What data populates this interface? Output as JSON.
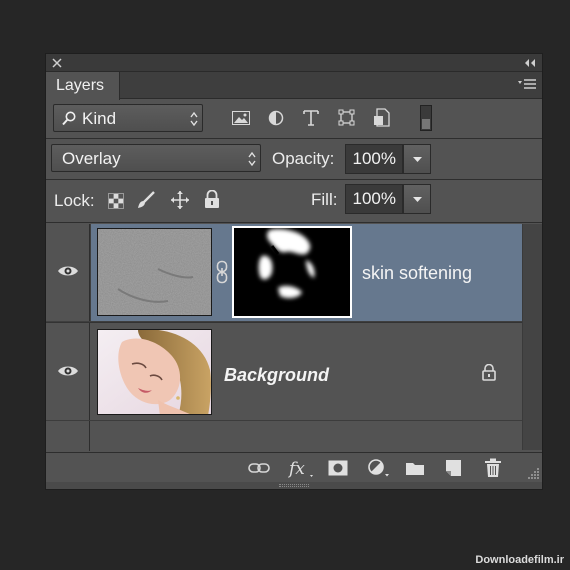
{
  "panel": {
    "title": "Layers",
    "filter": {
      "label": "Kind"
    },
    "blend_mode": "Overlay",
    "opacity": {
      "label": "Opacity:",
      "value": "100%"
    },
    "lock": {
      "label": "Lock:"
    },
    "fill": {
      "label": "Fill:",
      "value": "100%"
    },
    "layers": [
      {
        "name": "skin softening",
        "selected": true,
        "visible": true,
        "linked_mask": true
      },
      {
        "name": "Background",
        "selected": false,
        "visible": true,
        "locked": true
      }
    ],
    "filter_icons": [
      "image-filter-icon",
      "adjustment-filter-icon",
      "type-filter-icon",
      "shape-filter-icon",
      "smart-object-filter-icon",
      "filter-toggle-icon"
    ],
    "lock_icons": [
      "lock-transparent-pixels-icon",
      "lock-image-pixels-icon",
      "lock-position-icon",
      "lock-all-icon"
    ],
    "bottom_icons": [
      "link-layers-icon",
      "fx-icon",
      "add-mask-icon",
      "new-adjustment-layer-icon",
      "new-group-icon",
      "new-layer-icon",
      "delete-layer-icon"
    ]
  },
  "colors": {
    "panel_bg": "#535353",
    "selected_row": "#66788e",
    "app_bg": "#262626"
  },
  "watermark": "Downloadefilm.ir"
}
